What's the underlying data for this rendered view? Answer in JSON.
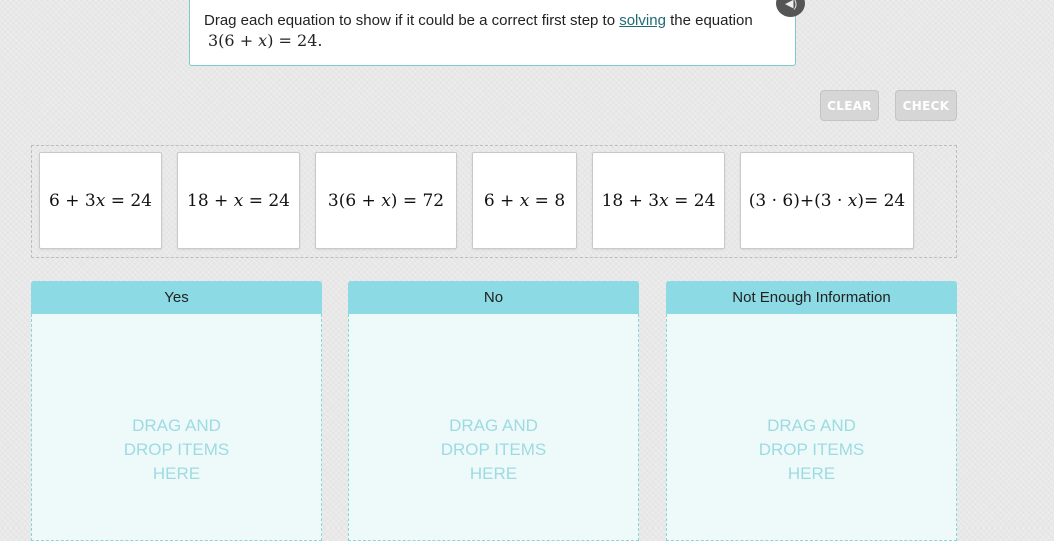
{
  "question": {
    "text_before": "Drag each equation to show if it could be a correct first step to ",
    "link": "solving",
    "text_after": " the equation",
    "equation": "3(6 + 𝑥) = 24."
  },
  "buttons": {
    "clear": "CLEAR",
    "check": "CHECK"
  },
  "cards": [
    "6 + 3𝑥 = 24",
    "18 + 𝑥 = 24",
    "3(6 + 𝑥) = 72",
    "6 + 𝑥 = 8",
    "18 + 3𝑥 = 24",
    "(3 · 6)+(3 · 𝑥)= 24"
  ],
  "zones": [
    {
      "title": "Yes",
      "hint": [
        "DRAG AND",
        "DROP ITEMS",
        "HERE"
      ]
    },
    {
      "title": "No",
      "hint": [
        "DRAG AND",
        "DROP ITEMS",
        "HERE"
      ]
    },
    {
      "title": "Not Enough Information",
      "hint": [
        "DRAG AND",
        "DROP ITEMS",
        "HERE"
      ]
    }
  ],
  "icons": {
    "speaker": "speaker-icon"
  },
  "colors": {
    "accent": "#8cdae3",
    "zone_bg": "#eef9fa",
    "hint": "#9ddbe3",
    "link": "#1e6b74"
  }
}
